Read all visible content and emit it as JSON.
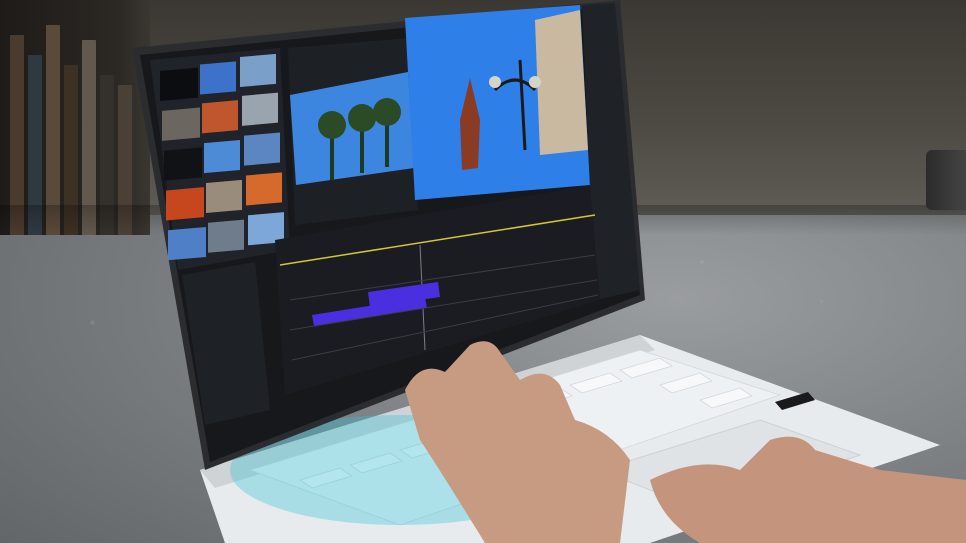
{
  "scene": {
    "subject": "laptop-video-editing",
    "colors": {
      "table": "#8d9093",
      "wall": "#46433d",
      "laptop_body": "#e9ecee",
      "screen_bg": "#1b1d22",
      "panel_bg": "#23262c",
      "timeline_clip": "#4a2fe0",
      "sky": "#2e7fe8",
      "accent_teal": "#33c3d6"
    },
    "icons": [
      "laptop-icon",
      "hand-icon",
      "play-icon"
    ]
  }
}
